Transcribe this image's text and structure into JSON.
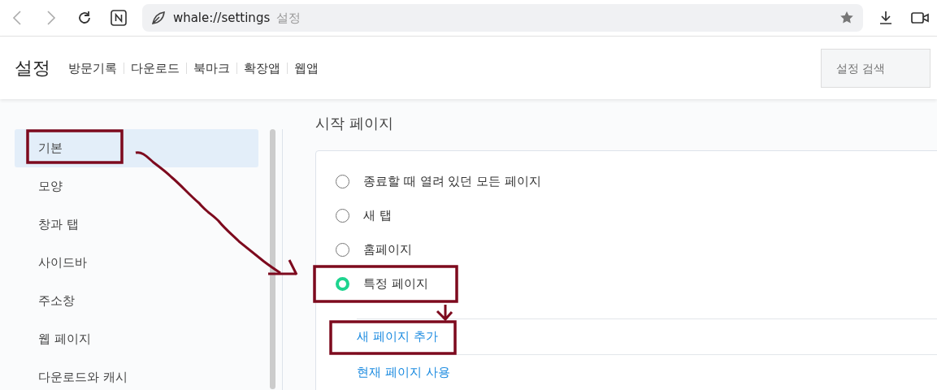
{
  "browser": {
    "url": "whale://settings",
    "page_title": "설정"
  },
  "header": {
    "title": "설정",
    "nav": [
      "방문기록",
      "다운로드",
      "북마크",
      "확장앱",
      "웹앱"
    ],
    "search": {
      "placeholder": "설정 검색"
    }
  },
  "sidebar": {
    "items": [
      {
        "label": "기본",
        "selected": true
      },
      {
        "label": "모양",
        "selected": false
      },
      {
        "label": "창과 탭",
        "selected": false
      },
      {
        "label": "사이드바",
        "selected": false
      },
      {
        "label": "주소창",
        "selected": false
      },
      {
        "label": "웹 페이지",
        "selected": false
      },
      {
        "label": "다운로드와 캐시",
        "selected": false
      }
    ]
  },
  "section": {
    "title": "시작 페이지",
    "options": [
      {
        "label": "종료할 때 열려 있던 모든 페이지",
        "selected": false
      },
      {
        "label": "새 탭",
        "selected": false
      },
      {
        "label": "홈페이지",
        "selected": false
      },
      {
        "label": "특정 페이지",
        "selected": true
      }
    ],
    "links": [
      "새 페이지 추가",
      "현재 페이지 사용"
    ]
  }
}
